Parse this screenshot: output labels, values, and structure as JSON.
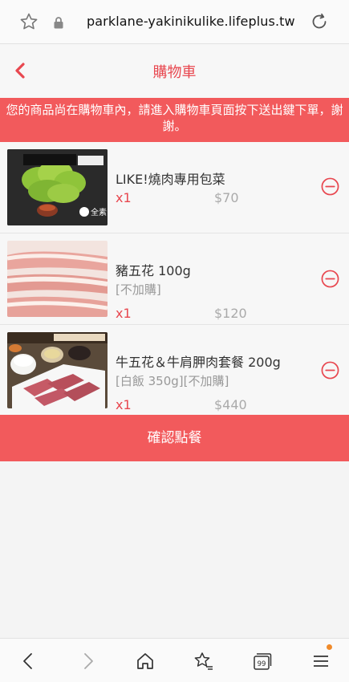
{
  "browser": {
    "url": "parklane-yakinikulike.lifeplus.tw",
    "icons": [
      "star-icon",
      "lock-icon",
      "reload-icon"
    ]
  },
  "header": {
    "title": "購物車",
    "back_icon": "chevron-left-icon",
    "accent_color": "#e8474f"
  },
  "notice": {
    "text": "您的商品尚在購物車內，請進入購物車頁面按下送出鍵下單，謝謝。",
    "background": "#f25a5c"
  },
  "cart": {
    "items": [
      {
        "name": "LIKE!燒肉專用包菜",
        "option": "",
        "qty": "x1",
        "price": "$70",
        "image": "lettuce-pack-photo",
        "image_text": "全素"
      },
      {
        "name": "豬五花 100g",
        "option": "[不加購]",
        "qty": "x1",
        "price": "$120",
        "image": "pork-belly-photo"
      },
      {
        "name": "牛五花＆牛肩胛肉套餐 200g",
        "option": "[白飯 350g][不加購]",
        "qty": "x1",
        "price": "$440",
        "image": "beef-set-photo"
      }
    ],
    "remove_icon": "minus-circle-icon"
  },
  "confirm": {
    "label": "確認點餐"
  },
  "bottom_nav": {
    "items": [
      "back-icon",
      "forward-icon",
      "home-icon",
      "bookmarks-icon",
      "tabs-icon",
      "menu-icon"
    ],
    "tabs_count": "99",
    "notification_color": "#f08a2a"
  }
}
